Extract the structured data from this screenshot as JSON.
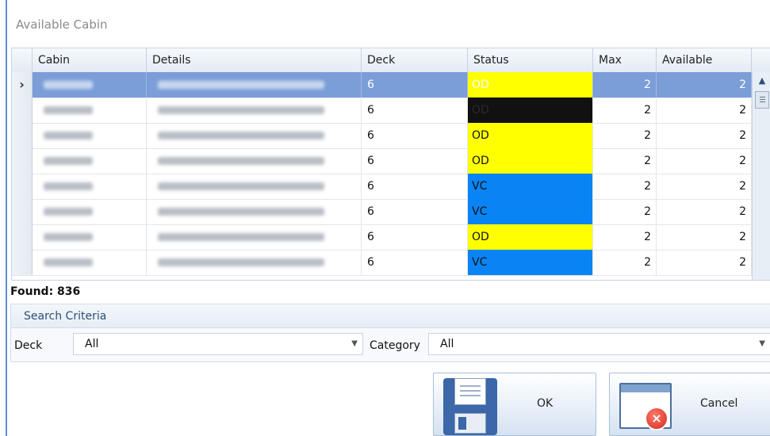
{
  "window": {
    "title": "Available Cabin"
  },
  "grid": {
    "columns": [
      "Cabin",
      "Details",
      "Deck",
      "Status",
      "Max",
      "Available"
    ],
    "selected_row_indicator": "›",
    "rows": [
      {
        "deck": "6",
        "status": "OD",
        "status_color": "#ffff00",
        "max": "2",
        "available": "2",
        "selected": true
      },
      {
        "deck": "6",
        "status": "OD",
        "status_color": "#111111",
        "max": "2",
        "available": "2"
      },
      {
        "deck": "6",
        "status": "OD",
        "status_color": "#ffff00",
        "max": "2",
        "available": "2"
      },
      {
        "deck": "6",
        "status": "OD",
        "status_color": "#ffff00",
        "max": "2",
        "available": "2"
      },
      {
        "deck": "6",
        "status": "VC",
        "status_color": "#0a84f5",
        "max": "2",
        "available": "2"
      },
      {
        "deck": "6",
        "status": "VC",
        "status_color": "#0a84f5",
        "max": "2",
        "available": "2"
      },
      {
        "deck": "6",
        "status": "OD",
        "status_color": "#ffff00",
        "max": "2",
        "available": "2"
      },
      {
        "deck": "6",
        "status": "VC",
        "status_color": "#0a84f5",
        "max": "2",
        "available": "2"
      }
    ]
  },
  "found": {
    "text": "Found: 836"
  },
  "search_criteria": {
    "title": "Search Criteria",
    "deck_label": "Deck",
    "deck_value": "All",
    "category_label": "Category",
    "category_value": "All"
  },
  "buttons": {
    "ok_label": "OK",
    "cancel_label": "Cancel"
  },
  "icons": {
    "ok": "floppy-disk-icon",
    "cancel": "window-close-icon",
    "scroll_up": "triangle-up-icon",
    "dropdown": "triangle-down-icon"
  }
}
